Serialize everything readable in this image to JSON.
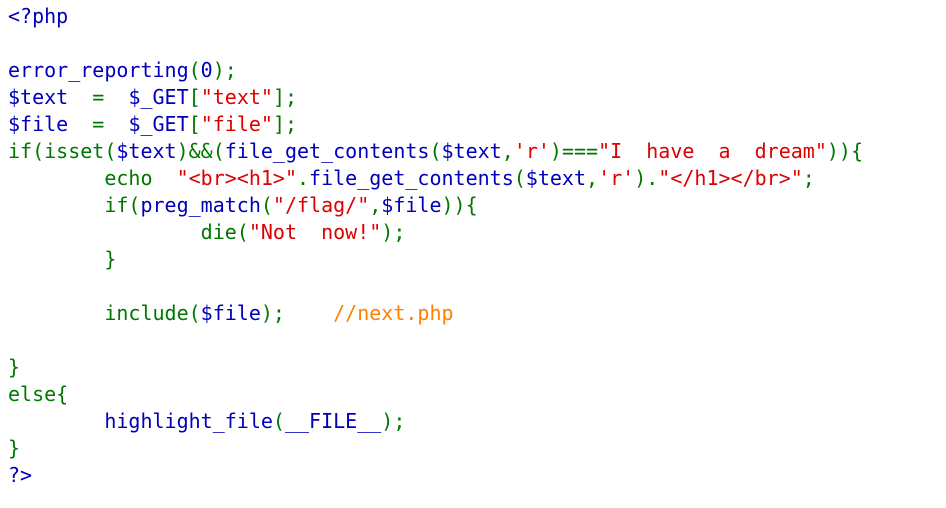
{
  "colors": {
    "default": "#0000BB",
    "keyword": "#007700",
    "string": "#DD0000",
    "comment": "#FF8000"
  },
  "lines": [
    {
      "tokens": [
        {
          "c": "default",
          "t": "<?php"
        }
      ]
    },
    {
      "tokens": []
    },
    {
      "tokens": [
        {
          "c": "default",
          "t": "error_reporting"
        },
        {
          "c": "keyword",
          "t": "("
        },
        {
          "c": "default",
          "t": "0"
        },
        {
          "c": "keyword",
          "t": ");"
        }
      ]
    },
    {
      "tokens": [
        {
          "c": "default",
          "t": "$text"
        },
        {
          "c": "keyword",
          "t": "  =  "
        },
        {
          "c": "default",
          "t": "$_GET"
        },
        {
          "c": "keyword",
          "t": "["
        },
        {
          "c": "string",
          "t": "\"text\""
        },
        {
          "c": "keyword",
          "t": "];"
        }
      ]
    },
    {
      "tokens": [
        {
          "c": "default",
          "t": "$file"
        },
        {
          "c": "keyword",
          "t": "  =  "
        },
        {
          "c": "default",
          "t": "$_GET"
        },
        {
          "c": "keyword",
          "t": "["
        },
        {
          "c": "string",
          "t": "\"file\""
        },
        {
          "c": "keyword",
          "t": "];"
        }
      ]
    },
    {
      "tokens": [
        {
          "c": "keyword",
          "t": "if(isset("
        },
        {
          "c": "default",
          "t": "$text"
        },
        {
          "c": "keyword",
          "t": ")&&("
        },
        {
          "c": "default",
          "t": "file_get_contents"
        },
        {
          "c": "keyword",
          "t": "("
        },
        {
          "c": "default",
          "t": "$text"
        },
        {
          "c": "keyword",
          "t": ","
        },
        {
          "c": "string",
          "t": "'r'"
        },
        {
          "c": "keyword",
          "t": ")==="
        },
        {
          "c": "string",
          "t": "\"I  have  a  dream\""
        },
        {
          "c": "keyword",
          "t": ")){"
        }
      ]
    },
    {
      "tokens": [
        {
          "c": "keyword",
          "t": "        echo  "
        },
        {
          "c": "string",
          "t": "\"<br><h1>\""
        },
        {
          "c": "keyword",
          "t": "."
        },
        {
          "c": "default",
          "t": "file_get_contents"
        },
        {
          "c": "keyword",
          "t": "("
        },
        {
          "c": "default",
          "t": "$text"
        },
        {
          "c": "keyword",
          "t": ","
        },
        {
          "c": "string",
          "t": "'r'"
        },
        {
          "c": "keyword",
          "t": ")."
        },
        {
          "c": "string",
          "t": "\"</h1></br>\""
        },
        {
          "c": "keyword",
          "t": ";"
        }
      ]
    },
    {
      "tokens": [
        {
          "c": "keyword",
          "t": "        if("
        },
        {
          "c": "default",
          "t": "preg_match"
        },
        {
          "c": "keyword",
          "t": "("
        },
        {
          "c": "string",
          "t": "\"/flag/\""
        },
        {
          "c": "keyword",
          "t": ","
        },
        {
          "c": "default",
          "t": "$file"
        },
        {
          "c": "keyword",
          "t": ")){"
        }
      ]
    },
    {
      "tokens": [
        {
          "c": "keyword",
          "t": "                die("
        },
        {
          "c": "string",
          "t": "\"Not  now!\""
        },
        {
          "c": "keyword",
          "t": ");"
        }
      ]
    },
    {
      "tokens": [
        {
          "c": "keyword",
          "t": "        }"
        }
      ]
    },
    {
      "tokens": []
    },
    {
      "tokens": [
        {
          "c": "keyword",
          "t": "        include("
        },
        {
          "c": "default",
          "t": "$file"
        },
        {
          "c": "keyword",
          "t": ");    "
        },
        {
          "c": "comment",
          "t": "//next.php"
        }
      ]
    },
    {
      "tokens": []
    },
    {
      "tokens": [
        {
          "c": "keyword",
          "t": "}"
        }
      ]
    },
    {
      "tokens": [
        {
          "c": "keyword",
          "t": "else{"
        }
      ]
    },
    {
      "tokens": [
        {
          "c": "keyword",
          "t": "        "
        },
        {
          "c": "default",
          "t": "highlight_file"
        },
        {
          "c": "keyword",
          "t": "("
        },
        {
          "c": "default",
          "t": "__FILE__"
        },
        {
          "c": "keyword",
          "t": ");"
        }
      ]
    },
    {
      "tokens": [
        {
          "c": "keyword",
          "t": "}"
        }
      ]
    },
    {
      "tokens": [
        {
          "c": "default",
          "t": "?>"
        }
      ]
    }
  ]
}
